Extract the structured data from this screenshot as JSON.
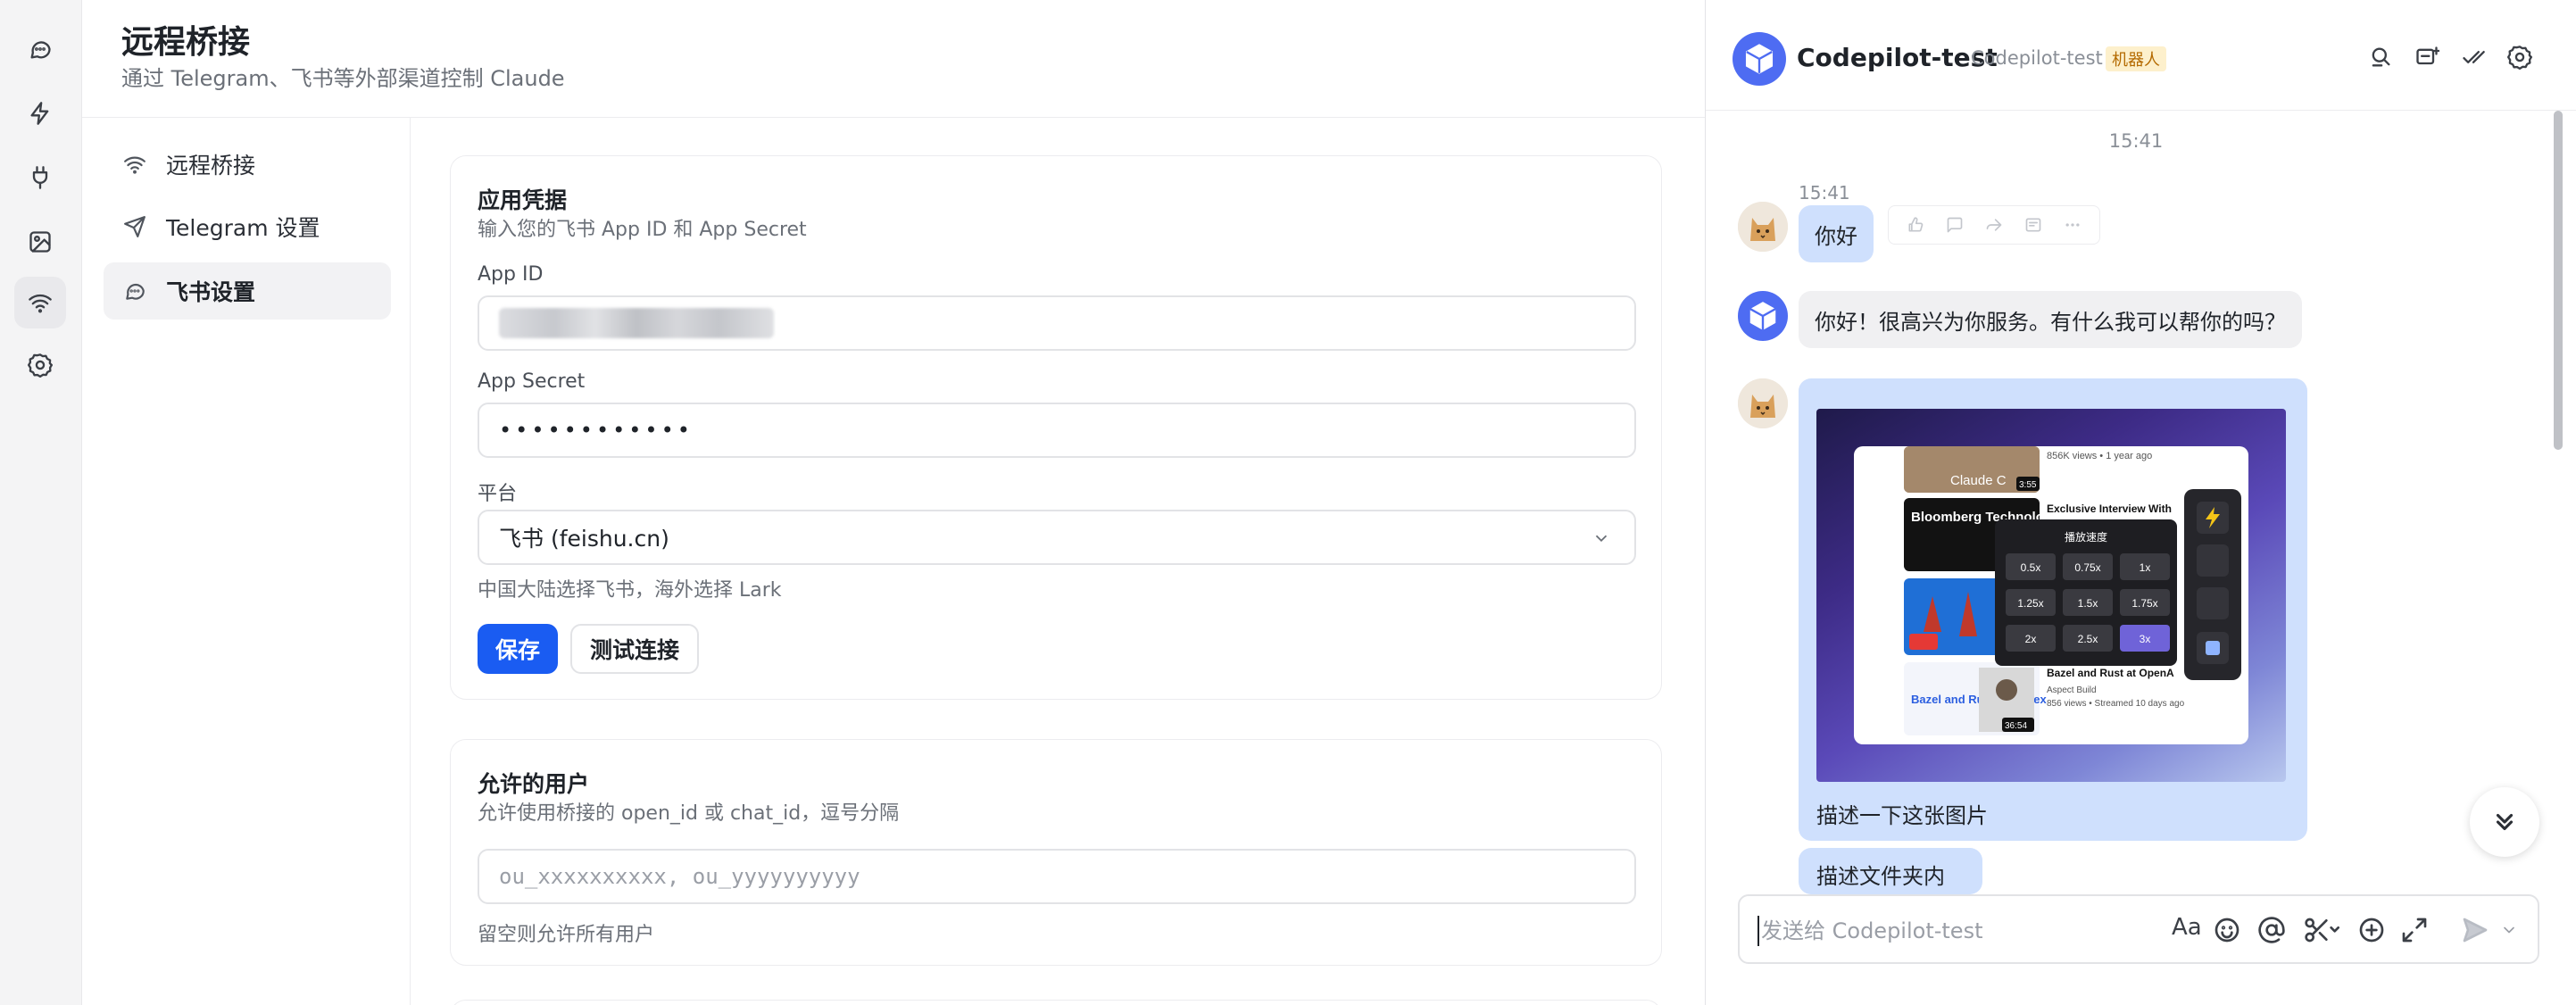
{
  "page": {
    "title": "远程桥接",
    "subtitle": "通过 Telegram、飞书等外部渠道控制 Claude"
  },
  "rail": {
    "icons": [
      "chat-icon",
      "bolt-icon",
      "plug-icon",
      "image-icon",
      "wifi-icon",
      "gear-icon"
    ],
    "active": "wifi-icon"
  },
  "nav": {
    "items": [
      {
        "label": "远程桥接",
        "icon": "wifi-icon"
      },
      {
        "label": "Telegram 设置",
        "icon": "send-icon"
      },
      {
        "label": "飞书设置",
        "icon": "chat-bubble-icon"
      }
    ],
    "active_index": 2
  },
  "credentials": {
    "title": "应用凭据",
    "description": "输入您的飞书 App ID 和 App Secret",
    "app_id_label": "App ID",
    "app_secret_label": "App Secret",
    "app_secret_value": "••••••••••••",
    "platform_label": "平台",
    "platform_value": "飞书 (feishu.cn)",
    "platform_hint": "中国大陆选择飞书，海外选择 Lark",
    "save_label": "保存",
    "test_label": "测试连接"
  },
  "allowed_users": {
    "title": "允许的用户",
    "description": "允许使用桥接的 open_id 或 chat_id，逗号分隔",
    "placeholder": "ou_xxxxxxxxxx, ou_yyyyyyyyyy",
    "hint": "留空则允许所有用户"
  },
  "chat": {
    "name": "Codepilot-test",
    "sub_name": "Codepilot-test",
    "bot_tag": "机器人",
    "center_time": "15:41",
    "header_icons": [
      "search-icon",
      "add-chat-icon",
      "check-icon",
      "settings-icon"
    ],
    "messages": [
      {
        "from": "user",
        "time": "15:41",
        "text": "你好"
      },
      {
        "from": "bot",
        "text": "你好！很高兴为你服务。有什么我可以帮你的吗？"
      },
      {
        "from": "user",
        "image_caption": "描述一下这张图片"
      },
      {
        "from": "user",
        "text": "描述文件夹内容"
      }
    ],
    "composer_placeholder": "发送给 Codepilot-test",
    "composer_text_format_label": "Aa"
  },
  "screenshot_image": {
    "video_items": [
      {
        "meta": "856K views • 1 year ago",
        "duration": "3:55",
        "thumb_text": "Claude C"
      },
      {
        "title": "Exclusive Interview With",
        "thumb_text": "Bloomberg Technology"
      },
      {
        "title": "Bazel and Rust at OpenA",
        "channel": "Aspect Build",
        "meta": "856 views • Streamed 10 days ago",
        "duration": "36:54",
        "thumb_text": "Bazel and Rust in Codex"
      }
    ],
    "speed_panel_title": "播放速度",
    "speeds": [
      "0.5x",
      "0.75x",
      "1x",
      "1.25x",
      "1.5x",
      "1.75x",
      "2x",
      "2.5x",
      "3x"
    ],
    "selected_speed": "3x"
  }
}
